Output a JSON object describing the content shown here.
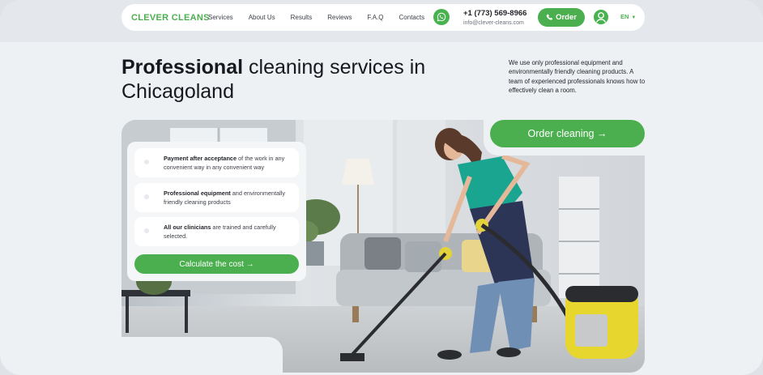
{
  "header": {
    "logo": "CLEVER CLEANS",
    "nav": [
      "Services",
      "About Us",
      "Results",
      "Reviews",
      "F.A.Q",
      "Contacts"
    ],
    "phone": "+1 (773) 569-8966",
    "email": "info@clever-cleans.com",
    "order_label": "Order",
    "language": "EN"
  },
  "hero": {
    "title_bold": "Professional",
    "title_rest": "cleaning services in Chicagoland",
    "description": "We use only professional equipment and environmentally friendly cleaning products. A team of experienced professionals knows how to effectively clean a room.",
    "cta_label": "Order cleaning →"
  },
  "features": [
    {
      "bold": "Payment after acceptance",
      "text": "of the work in any convenient way in any convenient way"
    },
    {
      "bold": "Professional equipment",
      "text": "and environmentally friendly cleaning products"
    },
    {
      "bold": "All our clinicians",
      "text": "are trained and carefully selected."
    }
  ],
  "calc_label": "Calculate the cost →",
  "colors": {
    "accent": "#4caf4f",
    "background": "#eef1f4",
    "text": "#16191d"
  },
  "icons": [
    "whatsapp-icon",
    "phone-icon",
    "user-icon",
    "chevron-down-icon",
    "arrow-right-icon"
  ]
}
